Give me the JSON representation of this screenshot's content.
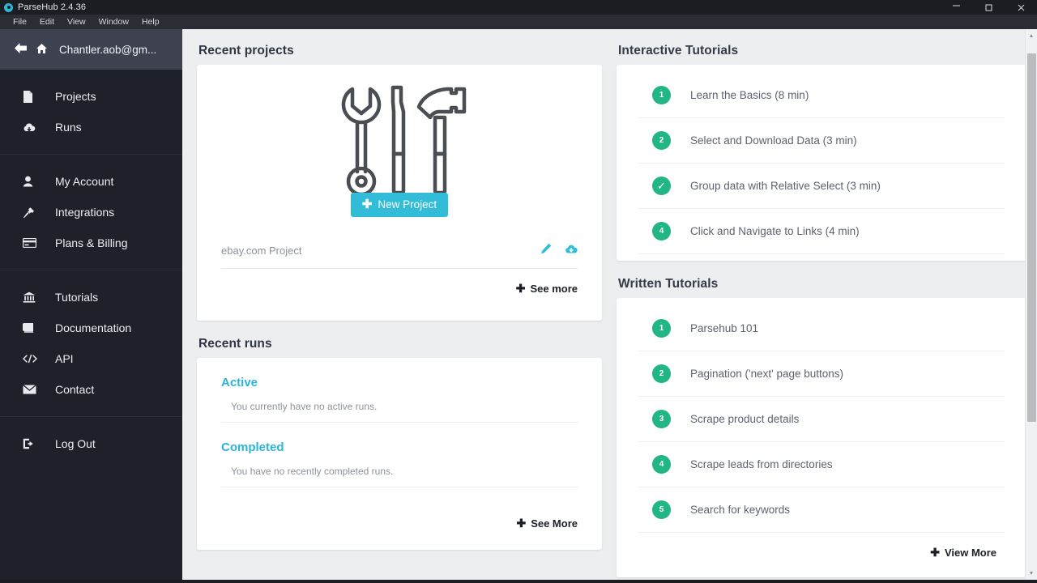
{
  "window": {
    "title": "ParseHub 2.4.36",
    "logo_icon": "parsehub-logo-icon",
    "minimize_label": "—",
    "maximize_label": "⬜",
    "close_label": "✕"
  },
  "menubar": {
    "items": [
      {
        "label": "File"
      },
      {
        "label": "Edit"
      },
      {
        "label": "View"
      },
      {
        "label": "Window"
      },
      {
        "label": "Help"
      }
    ]
  },
  "sidebar": {
    "header": {
      "back_icon": "back-arrow-icon",
      "home_icon": "home-icon",
      "account_email": "Chantler.aob@gm..."
    },
    "groups": [
      {
        "items": [
          {
            "label": "Projects",
            "icon": "document-icon"
          },
          {
            "label": "Runs",
            "icon": "cloud-icon"
          }
        ]
      },
      {
        "items": [
          {
            "label": "My Account",
            "icon": "user-icon"
          },
          {
            "label": "Integrations",
            "icon": "plug-icon"
          },
          {
            "label": "Plans & Billing",
            "icon": "credit-card-icon"
          }
        ]
      },
      {
        "items": [
          {
            "label": "Tutorials",
            "icon": "bank-icon"
          },
          {
            "label": "Documentation",
            "icon": "book-icon"
          },
          {
            "label": "API",
            "icon": "code-icon"
          },
          {
            "label": "Contact",
            "icon": "envelope-icon"
          }
        ]
      },
      {
        "items": [
          {
            "label": "Log Out",
            "icon": "logout-icon"
          }
        ]
      }
    ]
  },
  "recent_projects": {
    "title": "Recent projects",
    "illustration_icon": "tools-wrench-screwdriver-hammer-icon",
    "new_project_button": "New Project",
    "new_project_plus": "✚",
    "projects": [
      {
        "name": "ebay.com Project",
        "edit_icon": "pencil-icon",
        "download_icon": "cloud-download-icon"
      }
    ],
    "see_more": "See more",
    "see_more_plus": "✚"
  },
  "recent_runs": {
    "title": "Recent runs",
    "sections": [
      {
        "heading": "Active",
        "empty_text": "You currently have no active runs."
      },
      {
        "heading": "Completed",
        "empty_text": "You have no recently completed runs."
      }
    ],
    "see_more": "See More",
    "see_more_plus": "✚"
  },
  "interactive_tutorials": {
    "title": "Interactive Tutorials",
    "items": [
      {
        "badge": "1",
        "completed": false,
        "label": "Learn the Basics (8 min)"
      },
      {
        "badge": "2",
        "completed": false,
        "label": "Select and Download Data (3 min)"
      },
      {
        "badge": "✓",
        "completed": true,
        "label": "Group data with Relative Select (3 min)"
      },
      {
        "badge": "4",
        "completed": false,
        "label": "Click and Navigate to Links (4 min)"
      }
    ]
  },
  "written_tutorials": {
    "title": "Written Tutorials",
    "items": [
      {
        "badge": "1",
        "label": "Parsehub 101"
      },
      {
        "badge": "2",
        "label": "Pagination ('next' page buttons)"
      },
      {
        "badge": "3",
        "label": "Scrape product details"
      },
      {
        "badge": "4",
        "label": "Scrape leads from directories"
      },
      {
        "badge": "5",
        "label": "Search for keywords"
      }
    ],
    "view_more": "View More",
    "view_more_plus": "✚"
  },
  "scrollbar": {
    "up_arrow": "▲",
    "down_arrow": "▼"
  },
  "colors": {
    "accent_cyan": "#31bcd8",
    "accent_green": "#22b585",
    "sidebar_bg": "#1e212a",
    "sidebar_header_bg": "#3e4250",
    "content_bg": "#eceeef"
  }
}
